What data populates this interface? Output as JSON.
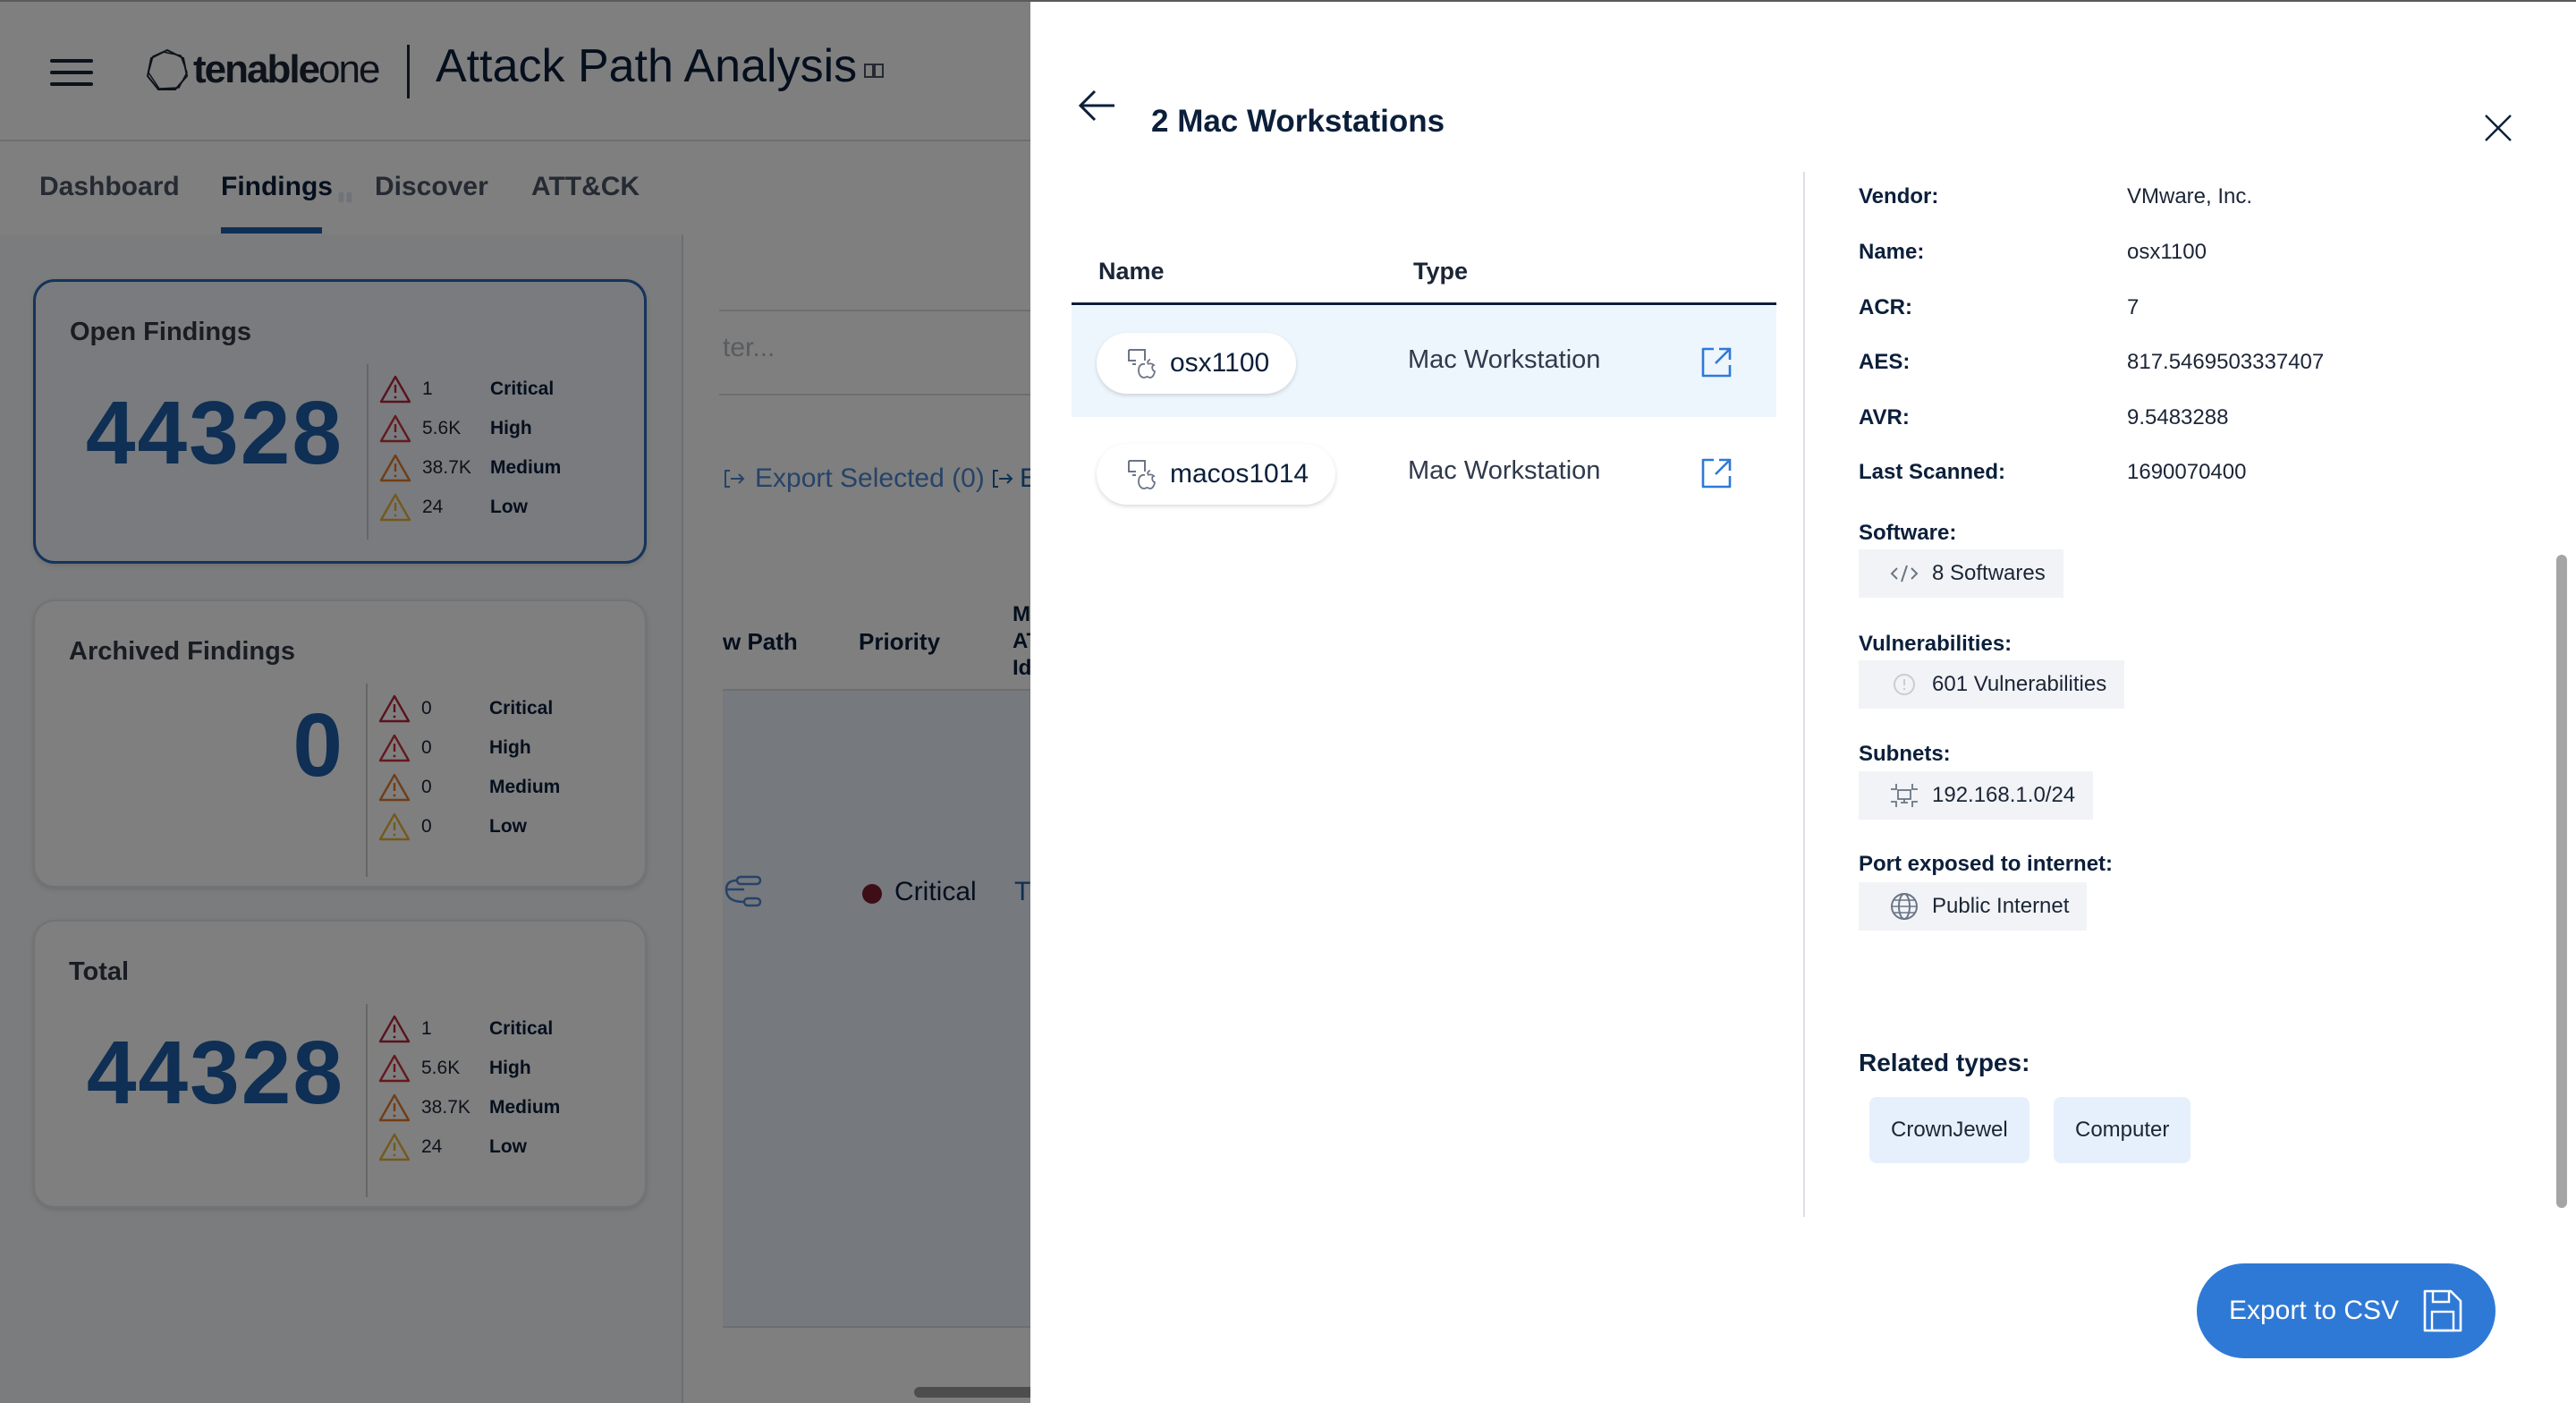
{
  "app": {
    "logo_brand": "tenable",
    "logo_product": "one",
    "title": "Attack Path Analysis",
    "menu_icon": "hamburger-menu-icon",
    "title_badge_icon": "book-icon"
  },
  "tabs": [
    {
      "label": "Dashboard",
      "active": false
    },
    {
      "label": "Findings",
      "active": true
    },
    {
      "label": "Discover",
      "active": false
    },
    {
      "label": "ATT&CK",
      "active": false
    }
  ],
  "summary_cards": [
    {
      "title": "Open Findings",
      "total": "44328",
      "selected": true,
      "severities": [
        {
          "count": "1",
          "label": "Critical",
          "color": "#b3263a"
        },
        {
          "count": "5.6K",
          "label": "High",
          "color": "#c8323a"
        },
        {
          "count": "38.7K",
          "label": "Medium",
          "color": "#e27a2c"
        },
        {
          "count": "24",
          "label": "Low",
          "color": "#e9b23a"
        }
      ]
    },
    {
      "title": "Archived Findings",
      "total": "0",
      "selected": false,
      "severities": [
        {
          "count": "0",
          "label": "Critical",
          "color": "#b3263a"
        },
        {
          "count": "0",
          "label": "High",
          "color": "#c8323a"
        },
        {
          "count": "0",
          "label": "Medium",
          "color": "#e27a2c"
        },
        {
          "count": "0",
          "label": "Low",
          "color": "#e9b23a"
        }
      ]
    },
    {
      "title": "Total",
      "total": "44328",
      "selected": false,
      "severities": [
        {
          "count": "1",
          "label": "Critical",
          "color": "#b3263a"
        },
        {
          "count": "5.6K",
          "label": "High",
          "color": "#c8323a"
        },
        {
          "count": "38.7K",
          "label": "Medium",
          "color": "#e27a2c"
        },
        {
          "count": "24",
          "label": "Low",
          "color": "#e9b23a"
        }
      ]
    }
  ],
  "findings_table": {
    "filter_placeholder_visible": "ter...",
    "export_selected_label": "Export Selected (0)",
    "export_all_label": "E",
    "columns": [
      "w Path",
      "Priority"
    ],
    "col_partial_multiline": [
      "M",
      "AT",
      "Id"
    ],
    "row": {
      "priority": "Critical",
      "priority_color": "#7a1c2b",
      "technique_partial": "T"
    }
  },
  "drawer": {
    "title": "2 Mac Workstations",
    "back_icon": "arrow-left-icon",
    "close_icon": "close-icon",
    "list": {
      "columns": {
        "name": "Name",
        "type": "Type"
      },
      "rows": [
        {
          "name": "osx1100",
          "type": "Mac Workstation",
          "selected": true
        },
        {
          "name": "macos1014",
          "type": "Mac Workstation",
          "selected": false
        }
      ]
    },
    "details": {
      "fields": [
        {
          "key": "Vendor:",
          "value": "VMware, Inc."
        },
        {
          "key": "Name:",
          "value": "osx1100"
        },
        {
          "key": "ACR:",
          "value": "7"
        },
        {
          "key": "AES:",
          "value": "817.5469503337407"
        },
        {
          "key": "AVR:",
          "value": "9.5483288"
        },
        {
          "key": "Last Scanned:",
          "value": "1690070400"
        }
      ],
      "sections": [
        {
          "label": "Software:",
          "chip": "8 Softwares",
          "icon": "code-icon"
        },
        {
          "label": "Vulnerabilities:",
          "chip": "601 Vulnerabilities",
          "icon": "alert-circle-icon"
        },
        {
          "label": "Subnets:",
          "chip": "192.168.1.0/24",
          "icon": "subnet-icon"
        },
        {
          "label": "Port exposed to internet:",
          "chip": "Public Internet",
          "icon": "globe-icon"
        }
      ],
      "related_label": "Related types:",
      "related_types": [
        "CrownJewel",
        "Computer"
      ]
    },
    "export_button": "Export to CSV",
    "accent_color": "#2f79d6"
  }
}
